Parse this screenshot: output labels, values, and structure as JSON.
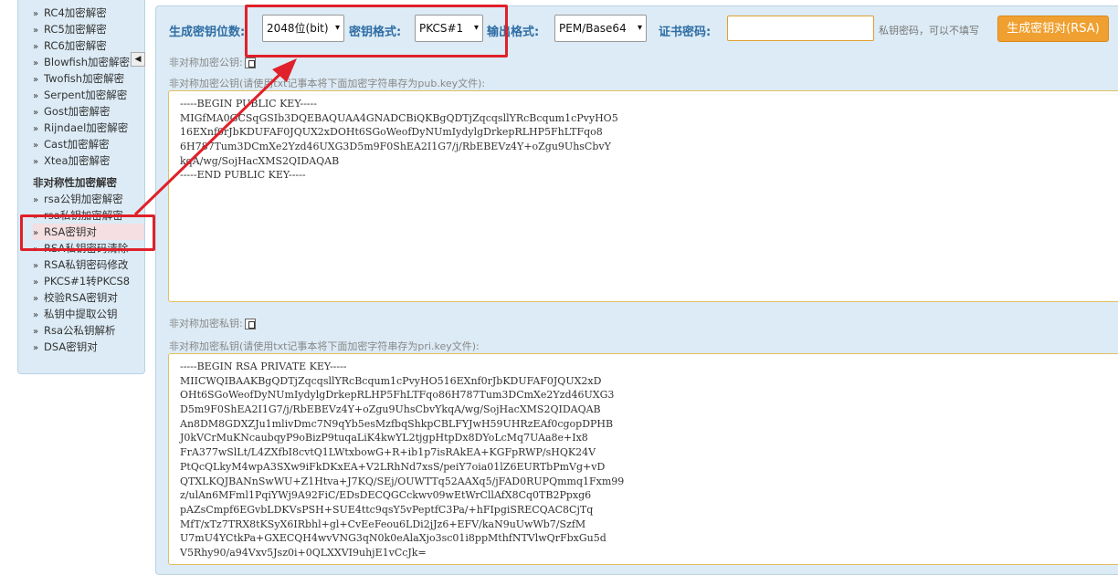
{
  "sidebar": {
    "items": [
      {
        "label": "RC4加密解密"
      },
      {
        "label": "RC5加密解密"
      },
      {
        "label": "RC6加密解密"
      },
      {
        "label": "Blowfish加密解密"
      },
      {
        "label": "Twofish加密解密"
      },
      {
        "label": "Serpent加密解密"
      },
      {
        "label": "Gost加密解密"
      },
      {
        "label": "Rijndael加密解密"
      },
      {
        "label": "Cast加密解密"
      },
      {
        "label": "Xtea加密解密"
      }
    ],
    "section_title": "非对称性加密解密",
    "items2": [
      {
        "label": "rsa公钥加密解密"
      },
      {
        "label": "rsa私钥加密解密"
      },
      {
        "label": "RSA密钥对"
      },
      {
        "label": "RSA私钥密码清除"
      },
      {
        "label": "RSA私钥密码修改"
      },
      {
        "label": "PKCS#1转PKCS8"
      },
      {
        "label": "校验RSA密钥对"
      },
      {
        "label": "私钥中提取公钥"
      },
      {
        "label": "Rsa公私钥解析"
      },
      {
        "label": "DSA密钥对"
      }
    ],
    "bullet": "»",
    "collapse_glyph": "◀"
  },
  "toolbar": {
    "bits_label": "生成密钥位数:",
    "bits_value": "2048位(bit)",
    "format_label": "密钥格式:",
    "format_value": "PKCS#1",
    "output_label": "输出格式:",
    "output_value": "PEM/Base64",
    "password_label": "证书密码:",
    "password_value": "",
    "password_hint": "私钥密码，可以不填写",
    "generate_label": "生成密钥对(RSA)",
    "caret": "▾"
  },
  "public_key": {
    "header": "非对称加密公钥:",
    "caption": "非对称加密公钥(请使用txt记事本将下面加密字符串存为pub.key文件):",
    "lines": [
      "-----BEGIN PUBLIC KEY-----",
      "MIGfMA0GCSqGSIb3DQEBAQUAA4GNADCBiQKBgQDTjZqcqsllYRcBcqum1cPvyHO5",
      "16EXnf0rJbKDUFAF0JQUX2xDOHt6SGoWeofDyNUmIydylgDrkepRLHP5FhLTFqo8",
      "6H787Tum3DCmXe2Yzd46UXG3D5m9F0ShEA2I1G7/j/RbEBEVz4Y+oZgu9UhsCbvY",
      "kqA/wg/SojHacXMS2QIDAQAB",
      "-----END PUBLIC KEY-----"
    ]
  },
  "private_key": {
    "header": "非对称加密私钥:",
    "caption": "非对称加密私钥(请使用txt记事本将下面加密字符串存为pri.key文件):",
    "lines": [
      "-----BEGIN RSA PRIVATE KEY-----",
      "MIICWQIBAAKBgQDTjZqcqsllYRcBcqum1cPvyHO516EXnf0rJbKDUFAF0JQUX2xD",
      "OHt6SGoWeofDyNUmIydylgDrkepRLHP5FhLTFqo86H787Tum3DCmXe2Yzd46UXG3",
      "D5m9F0ShEA2I1G7/j/RbEBEVz4Y+oZgu9UhsCbvYkqA/wg/SojHacXMS2QIDAQAB",
      "An8DM8GDXZJu1mlivDmc7N9qYb5esMzfbqShkpCBLFYJwH59UHRzEAf0cgopDPHB",
      "J0kVCrMuKNcaubqyP9oBizP9tuqaLiK4kwYL2tjgpHtpDx8DYoLcMq7UAa8e+Ix8",
      "FrA377wSlLt/L4ZXfbI8cvtQ1LWtxbowG+R+ib1p7isRAkEA+KGFpRWP/sHQK24V",
      "PtQcQLkyM4wpA3SXw9iFkDKxEA+V2LRhNd7xsS/peiY7oia01lZ6EURTbPmVg+vD",
      "QTXLKQJBANnSwWU+Z1Htva+J7KQ/SEj/OUWTTq52AAXq5/jFAD0RUPQmmq1Fxm99",
      "z/ulAn6MFml1PqiYWj9A92FiC/EDsDECQGCckwv09wEtWrCllAfX8Cq0TB2Ppxg6",
      "pAZsCmpf6EGvbLDKVsPSH+SUE4ttc9qsY5vPeptfC3Pa/+hFIpgiSRECQAC8CjTq",
      "MfT/xTz7TRX8tKSyX6IRbhl+gl+CvEeFeou6LDi2jJz6+EFV/kaN9uUwWb7/SzfM",
      "U7mU4YCtkPa+GXECQH4wvVNG3qN0k0eAlaXjo3sc01i8ppMthfNTVlwQrFbxGu5d",
      "V5Rhy90/a94Vxv5Jsz0i+0QLXXVI9uhjE1vCcJk="
    ]
  },
  "annotation_color": "#e0202a"
}
